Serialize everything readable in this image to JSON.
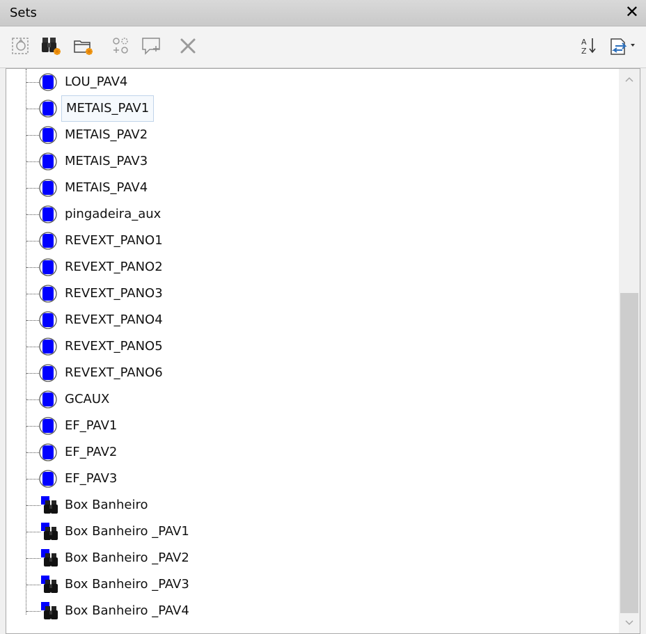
{
  "panel": {
    "title": "Sets",
    "close_glyph": "✕"
  },
  "toolbar": {
    "buttons": [
      {
        "icon": "save-selection-icon",
        "enabled": false
      },
      {
        "icon": "save-search-icon",
        "enabled": true
      },
      {
        "icon": "new-folder-icon",
        "enabled": true
      },
      {
        "icon": "duplicate-icon",
        "enabled": false
      },
      {
        "icon": "add-comment-icon",
        "enabled": false
      },
      {
        "icon": "delete-icon",
        "enabled": false
      },
      {
        "icon": "sort-az-icon",
        "enabled": true
      },
      {
        "icon": "import-export-icon",
        "enabled": true
      }
    ]
  },
  "tree": {
    "items": [
      {
        "label": "LOU_PAV4",
        "type": "selection-set"
      },
      {
        "label": "METAIS_PAV1",
        "type": "selection-set",
        "selected": true
      },
      {
        "label": "METAIS_PAV2",
        "type": "selection-set"
      },
      {
        "label": "METAIS_PAV3",
        "type": "selection-set"
      },
      {
        "label": "METAIS_PAV4",
        "type": "selection-set"
      },
      {
        "label": "pingadeira_aux",
        "type": "selection-set"
      },
      {
        "label": "REVEXT_PANO1",
        "type": "selection-set"
      },
      {
        "label": "REVEXT_PANO2",
        "type": "selection-set"
      },
      {
        "label": "REVEXT_PANO3",
        "type": "selection-set"
      },
      {
        "label": "REVEXT_PANO4",
        "type": "selection-set"
      },
      {
        "label": "REVEXT_PANO5",
        "type": "selection-set"
      },
      {
        "label": "REVEXT_PANO6",
        "type": "selection-set"
      },
      {
        "label": "GCAUX",
        "type": "selection-set"
      },
      {
        "label": "EF_PAV1",
        "type": "selection-set"
      },
      {
        "label": "EF_PAV2",
        "type": "selection-set"
      },
      {
        "label": "EF_PAV3",
        "type": "selection-set"
      },
      {
        "label": "Box Banheiro",
        "type": "search-set"
      },
      {
        "label": "Box Banheiro _PAV1",
        "type": "search-set"
      },
      {
        "label": "Box Banheiro _PAV2",
        "type": "search-set"
      },
      {
        "label": "Box Banheiro _PAV3",
        "type": "search-set"
      },
      {
        "label": "Box Banheiro _PAV4",
        "type": "search-set"
      }
    ]
  },
  "colors": {
    "set_blue": "#0000ff",
    "selected_border": "#c0d4ea",
    "scroll_thumb": "#cdcdcd"
  }
}
